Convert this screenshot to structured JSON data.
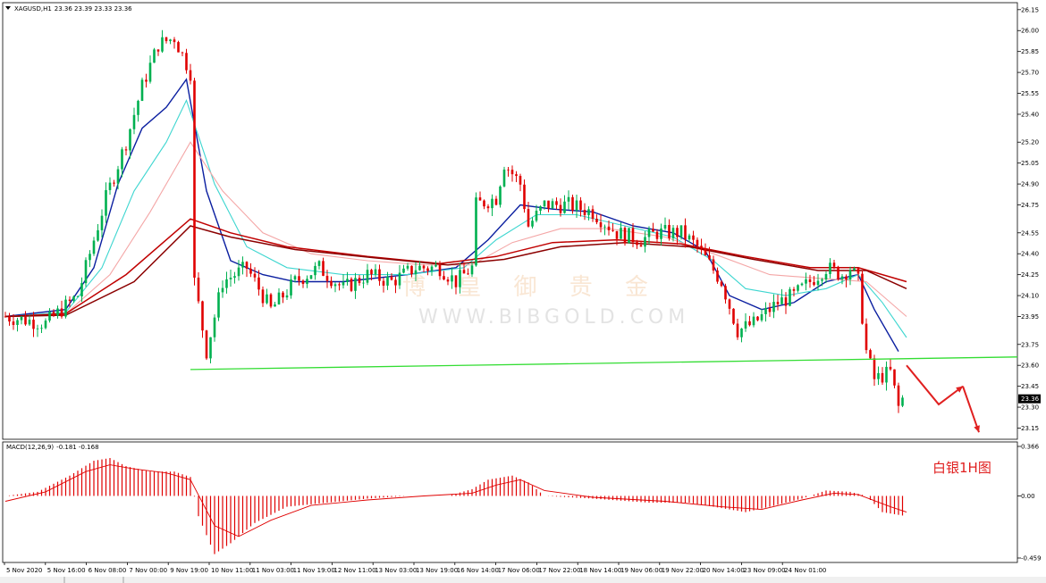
{
  "header": {
    "symbol": "XAGUSD,H1",
    "ohlc": "23.36 23.39 23.33 23.36",
    "macd_label": "MACD(12,26,9)",
    "macd_values": "-0.181 -0.168"
  },
  "annotation": {
    "label": "白银1H图"
  },
  "watermark": {
    "cn": "博 皇 御 贵 金",
    "en": "WWW.BIBGOLD.COM"
  },
  "price_tag": "23.36",
  "colors": {
    "bull": "#00b050",
    "bear": "#e00000",
    "ma_blue": "#0b1fa0",
    "ma_cyan": "#3ed6d0",
    "ma_pink": "#f4a6a6",
    "ma_red": "#c00000",
    "ma_darkred": "#8b0000",
    "support": "#33dd33",
    "macd_hist": "#e00000",
    "macd_signal": "#e00000",
    "arrow": "#e02020"
  },
  "chart_data": {
    "type": "candlestick",
    "price_axis": {
      "ticks": [
        "26.15",
        "26.00",
        "25.85",
        "25.70",
        "25.55",
        "25.40",
        "25.20",
        "25.05",
        "24.90",
        "24.75",
        "24.55",
        "24.40",
        "24.25",
        "24.10",
        "23.95",
        "23.75",
        "23.60",
        "23.45",
        "23.30",
        "23.15"
      ],
      "range": [
        23.07,
        26.2
      ]
    },
    "macd_axis": {
      "ticks": [
        "0.366",
        "0.00",
        "-0.459"
      ],
      "range": [
        -0.459,
        0.366
      ]
    },
    "time_axis": [
      "5 Nov 2020",
      "5 Nov 16:00",
      "6 Nov 08:00",
      "7 Nov 00:00",
      "9 Nov 19:00",
      "10 Nov 11:00",
      "11 Nov 03:00",
      "11 Nov 19:00",
      "12 Nov 11:00",
      "13 Nov 03:00",
      "13 Nov 19:00",
      "16 Nov 14:00",
      "17 Nov 06:00",
      "17 Nov 22:00",
      "18 Nov 14:00",
      "19 Nov 06:00",
      "19 Nov 22:00",
      "20 Nov 14:00",
      "23 Nov 09:00",
      "24 Nov 01:00"
    ],
    "close_path": [
      [
        0,
        23.95
      ],
      [
        10,
        23.9
      ],
      [
        18,
        24.1
      ],
      [
        25,
        24.8
      ],
      [
        30,
        25.2
      ],
      [
        34,
        25.6
      ],
      [
        38,
        25.9
      ],
      [
        42,
        25.95
      ],
      [
        46,
        25.7
      ],
      [
        47,
        24.2
      ],
      [
        50,
        23.7
      ],
      [
        54,
        24.2
      ],
      [
        60,
        24.3
      ],
      [
        66,
        24.0
      ],
      [
        72,
        24.2
      ],
      [
        78,
        24.3
      ],
      [
        84,
        24.15
      ],
      [
        90,
        24.25
      ],
      [
        96,
        24.2
      ],
      [
        102,
        24.3
      ],
      [
        108,
        24.3
      ],
      [
        112,
        24.2
      ],
      [
        116,
        24.3
      ],
      [
        117,
        24.75
      ],
      [
        122,
        24.8
      ],
      [
        124,
        25.05
      ],
      [
        128,
        24.9
      ],
      [
        130,
        24.6
      ],
      [
        134,
        24.75
      ],
      [
        140,
        24.75
      ],
      [
        146,
        24.7
      ],
      [
        152,
        24.55
      ],
      [
        158,
        24.5
      ],
      [
        162,
        24.55
      ],
      [
        168,
        24.55
      ],
      [
        172,
        24.45
      ],
      [
        178,
        24.2
      ],
      [
        182,
        23.85
      ],
      [
        186,
        23.9
      ],
      [
        192,
        24.05
      ],
      [
        196,
        24.1
      ],
      [
        200,
        24.2
      ],
      [
        204,
        24.3
      ],
      [
        208,
        24.25
      ],
      [
        210,
        24.3
      ],
      [
        212,
        24.2
      ],
      [
        214,
        23.7
      ],
      [
        216,
        23.5
      ],
      [
        220,
        23.55
      ],
      [
        222,
        23.3
      ],
      [
        223,
        23.36
      ]
    ],
    "series": [
      {
        "kind": "ma",
        "color": "ma_blue",
        "points": [
          [
            0,
            23.95
          ],
          [
            15,
            24.0
          ],
          [
            22,
            24.3
          ],
          [
            28,
            24.9
          ],
          [
            34,
            25.3
          ],
          [
            40,
            25.45
          ],
          [
            45,
            25.65
          ],
          [
            50,
            24.85
          ],
          [
            56,
            24.35
          ],
          [
            64,
            24.25
          ],
          [
            72,
            24.2
          ],
          [
            84,
            24.2
          ],
          [
            100,
            24.25
          ],
          [
            112,
            24.3
          ],
          [
            120,
            24.5
          ],
          [
            128,
            24.75
          ],
          [
            136,
            24.72
          ],
          [
            146,
            24.7
          ],
          [
            156,
            24.6
          ],
          [
            166,
            24.55
          ],
          [
            174,
            24.42
          ],
          [
            180,
            24.1
          ],
          [
            188,
            24.0
          ],
          [
            196,
            24.05
          ],
          [
            204,
            24.2
          ],
          [
            212,
            24.25
          ],
          [
            216,
            24.0
          ],
          [
            222,
            23.7
          ]
        ]
      },
      {
        "kind": "ma",
        "color": "ma_cyan",
        "points": [
          [
            0,
            23.95
          ],
          [
            15,
            23.98
          ],
          [
            24,
            24.3
          ],
          [
            32,
            24.85
          ],
          [
            40,
            25.2
          ],
          [
            45,
            25.5
          ],
          [
            52,
            24.9
          ],
          [
            60,
            24.45
          ],
          [
            70,
            24.3
          ],
          [
            84,
            24.25
          ],
          [
            100,
            24.25
          ],
          [
            114,
            24.3
          ],
          [
            122,
            24.5
          ],
          [
            132,
            24.68
          ],
          [
            142,
            24.68
          ],
          [
            154,
            24.6
          ],
          [
            166,
            24.52
          ],
          [
            176,
            24.35
          ],
          [
            184,
            24.15
          ],
          [
            194,
            24.1
          ],
          [
            204,
            24.15
          ],
          [
            212,
            24.25
          ],
          [
            218,
            24.05
          ],
          [
            224,
            23.8
          ]
        ]
      },
      {
        "kind": "ma",
        "color": "ma_pink",
        "points": [
          [
            0,
            23.95
          ],
          [
            15,
            23.97
          ],
          [
            26,
            24.25
          ],
          [
            36,
            24.7
          ],
          [
            42,
            25.0
          ],
          [
            46,
            25.2
          ],
          [
            54,
            24.85
          ],
          [
            64,
            24.55
          ],
          [
            76,
            24.4
          ],
          [
            90,
            24.35
          ],
          [
            104,
            24.32
          ],
          [
            116,
            24.32
          ],
          [
            126,
            24.48
          ],
          [
            138,
            24.58
          ],
          [
            150,
            24.58
          ],
          [
            164,
            24.52
          ],
          [
            176,
            24.4
          ],
          [
            190,
            24.25
          ],
          [
            204,
            24.22
          ],
          [
            214,
            24.2
          ],
          [
            224,
            23.95
          ]
        ]
      },
      {
        "kind": "ma",
        "color": "ma_red",
        "points": [
          [
            0,
            23.95
          ],
          [
            15,
            23.97
          ],
          [
            30,
            24.25
          ],
          [
            46,
            24.65
          ],
          [
            56,
            24.55
          ],
          [
            70,
            24.45
          ],
          [
            90,
            24.38
          ],
          [
            108,
            24.33
          ],
          [
            122,
            24.38
          ],
          [
            136,
            24.48
          ],
          [
            152,
            24.5
          ],
          [
            168,
            24.47
          ],
          [
            184,
            24.38
          ],
          [
            200,
            24.3
          ],
          [
            212,
            24.3
          ],
          [
            224,
            24.2
          ]
        ]
      },
      {
        "kind": "ma",
        "color": "ma_darkred",
        "points": [
          [
            0,
            23.95
          ],
          [
            15,
            23.96
          ],
          [
            32,
            24.2
          ],
          [
            46,
            24.6
          ],
          [
            56,
            24.52
          ],
          [
            72,
            24.43
          ],
          [
            92,
            24.37
          ],
          [
            110,
            24.32
          ],
          [
            124,
            24.36
          ],
          [
            138,
            24.45
          ],
          [
            154,
            24.48
          ],
          [
            170,
            24.45
          ],
          [
            186,
            24.36
          ],
          [
            202,
            24.28
          ],
          [
            214,
            24.28
          ],
          [
            224,
            24.15
          ]
        ]
      }
    ],
    "support_line": {
      "from": [
        46,
        23.57
      ],
      "to": [
        280,
        23.66
      ]
    },
    "projection_arrows": [
      [
        [
          224,
          23.6
        ],
        [
          232,
          23.32
        ],
        [
          238,
          23.45
        ]
      ],
      [
        [
          238,
          23.45
        ],
        [
          242,
          23.12
        ]
      ]
    ],
    "macd_hist": [
      [
        0,
        0.0
      ],
      [
        8,
        0.03
      ],
      [
        16,
        0.15
      ],
      [
        22,
        0.26
      ],
      [
        26,
        0.28
      ],
      [
        30,
        0.22
      ],
      [
        36,
        0.18
      ],
      [
        42,
        0.18
      ],
      [
        46,
        0.14
      ],
      [
        48,
        -0.15
      ],
      [
        52,
        -0.43
      ],
      [
        56,
        -0.35
      ],
      [
        62,
        -0.2
      ],
      [
        70,
        -0.08
      ],
      [
        80,
        -0.05
      ],
      [
        90,
        -0.02
      ],
      [
        100,
        0.0
      ],
      [
        110,
        0.0
      ],
      [
        116,
        0.05
      ],
      [
        120,
        0.12
      ],
      [
        126,
        0.15
      ],
      [
        130,
        0.1
      ],
      [
        134,
        0.0
      ],
      [
        146,
        -0.02
      ],
      [
        160,
        -0.05
      ],
      [
        170,
        -0.05
      ],
      [
        176,
        -0.08
      ],
      [
        184,
        -0.12
      ],
      [
        190,
        -0.08
      ],
      [
        198,
        -0.02
      ],
      [
        204,
        0.04
      ],
      [
        210,
        0.03
      ],
      [
        214,
        0.0
      ],
      [
        218,
        -0.12
      ],
      [
        224,
        -0.15
      ]
    ],
    "macd_signal": [
      [
        0,
        -0.04
      ],
      [
        10,
        0.03
      ],
      [
        20,
        0.18
      ],
      [
        26,
        0.23
      ],
      [
        32,
        0.2
      ],
      [
        40,
        0.17
      ],
      [
        46,
        0.12
      ],
      [
        52,
        -0.22
      ],
      [
        58,
        -0.3
      ],
      [
        66,
        -0.18
      ],
      [
        76,
        -0.07
      ],
      [
        90,
        -0.03
      ],
      [
        104,
        0.0
      ],
      [
        116,
        0.02
      ],
      [
        122,
        0.08
      ],
      [
        128,
        0.12
      ],
      [
        134,
        0.04
      ],
      [
        146,
        -0.01
      ],
      [
        164,
        -0.04
      ],
      [
        178,
        -0.08
      ],
      [
        188,
        -0.1
      ],
      [
        198,
        -0.03
      ],
      [
        206,
        0.02
      ],
      [
        212,
        0.01
      ],
      [
        220,
        -0.08
      ],
      [
        224,
        -0.12
      ]
    ]
  }
}
